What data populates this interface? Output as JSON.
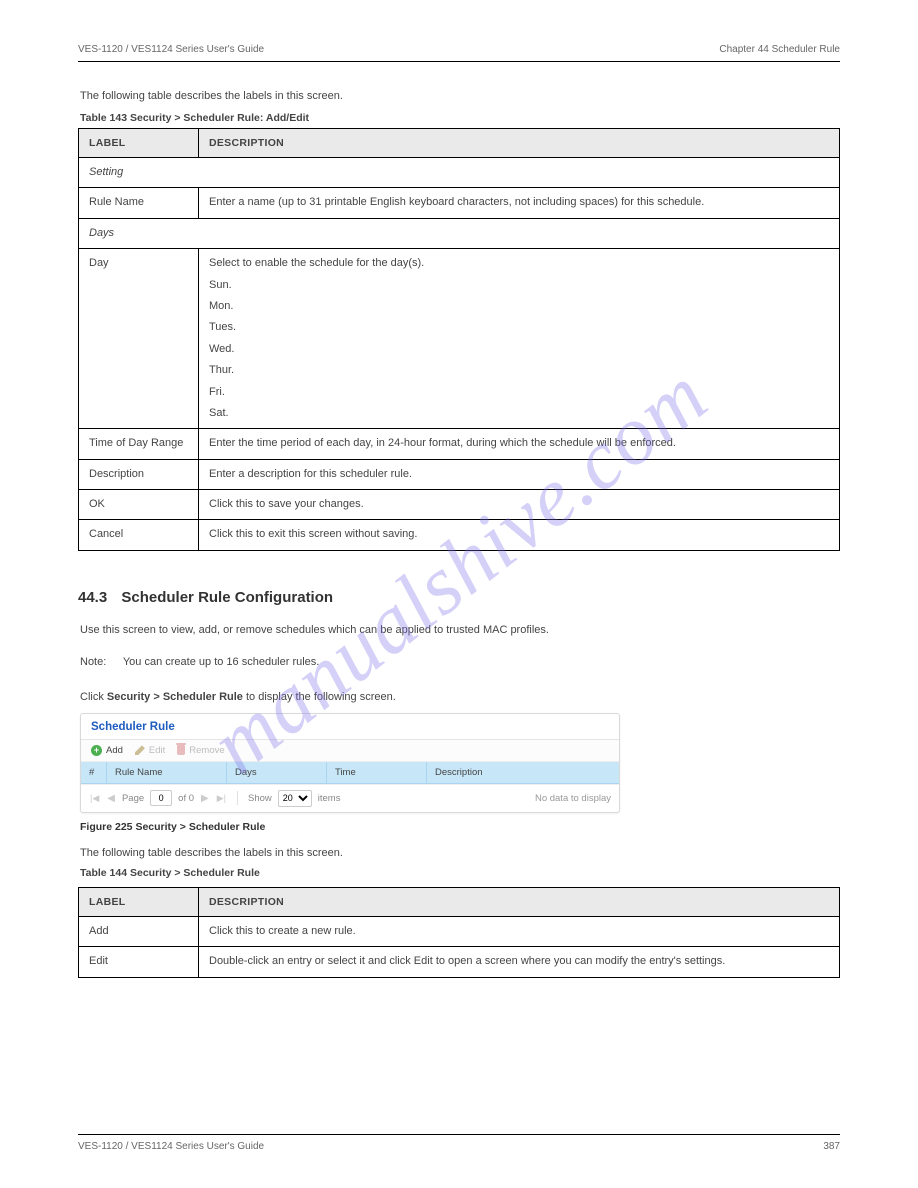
{
  "header": {
    "left": "VES-1120 / VES1124 Series User's Guide",
    "right": "Chapter 44 Scheduler Rule"
  },
  "intro": "The following table describes the labels in this screen.",
  "table143": {
    "caption": "Table 143   Security > Scheduler Rule: Add/Edit",
    "columns": [
      "LABEL",
      "DESCRIPTION"
    ],
    "section1": "Setting",
    "rows1": [
      {
        "label": "Rule Name",
        "desc": "Enter a name (up to 31 printable English keyboard characters, not including spaces) for this schedule."
      }
    ],
    "section2": "Days",
    "rows2": [
      {
        "label": "Day",
        "desc_lines": [
          "Select to enable the schedule for the day(s).",
          "Sun.",
          "Mon.",
          "Tues.",
          "Wed.",
          "Thur.",
          "Fri.",
          "Sat."
        ]
      },
      {
        "label": "Time of Day Range",
        "desc": "Enter the time period of each day, in 24-hour format, during which the schedule will be enforced."
      },
      {
        "label": "Description",
        "desc": "Enter a description for this scheduler rule."
      },
      {
        "label": "OK",
        "desc": "Click this to save your changes."
      },
      {
        "label": "Cancel",
        "desc": "Click this to exit this screen without saving."
      }
    ]
  },
  "section": {
    "number": "44.3",
    "title": "Scheduler Rule Configuration",
    "text1": "Use this screen to view, add, or remove schedules which can be applied to trusted MAC profiles.",
    "note_label": "Note:",
    "note_text": "You can create up to 16 scheduler rules.",
    "path_prefix": "Click ",
    "path": "Security > Scheduler Rule",
    "path_suffix": " to display the following screen."
  },
  "shot": {
    "title": "Scheduler Rule",
    "toolbar": {
      "add": "Add",
      "edit": "Edit",
      "remove": "Remove"
    },
    "columns": {
      "idx": "#",
      "name": "Rule Name",
      "days": "Days",
      "time": "Time",
      "desc": "Description"
    },
    "pager": {
      "page_label": "Page",
      "page_value": "0",
      "of_text": "of 0",
      "show_label": "Show",
      "per_page": "20",
      "items_label": "items",
      "empty": "No data to display"
    }
  },
  "fig_caption": "Figure 225   Security > Scheduler Rule",
  "table144": {
    "intro": "The following table describes the labels in this screen.",
    "caption": "Table 144   Security > Scheduler Rule",
    "columns": [
      "LABEL",
      "DESCRIPTION"
    ],
    "rows": [
      {
        "label": "Add",
        "desc": "Click this to create a new rule."
      },
      {
        "label": "Edit",
        "desc": "Double-click an entry or select it and click Edit to open a screen where you can modify the entry's settings."
      }
    ]
  },
  "footer": {
    "left": "VES-1120 / VES1124 Series User's Guide",
    "right": "387"
  },
  "watermark": "manualshive.com"
}
